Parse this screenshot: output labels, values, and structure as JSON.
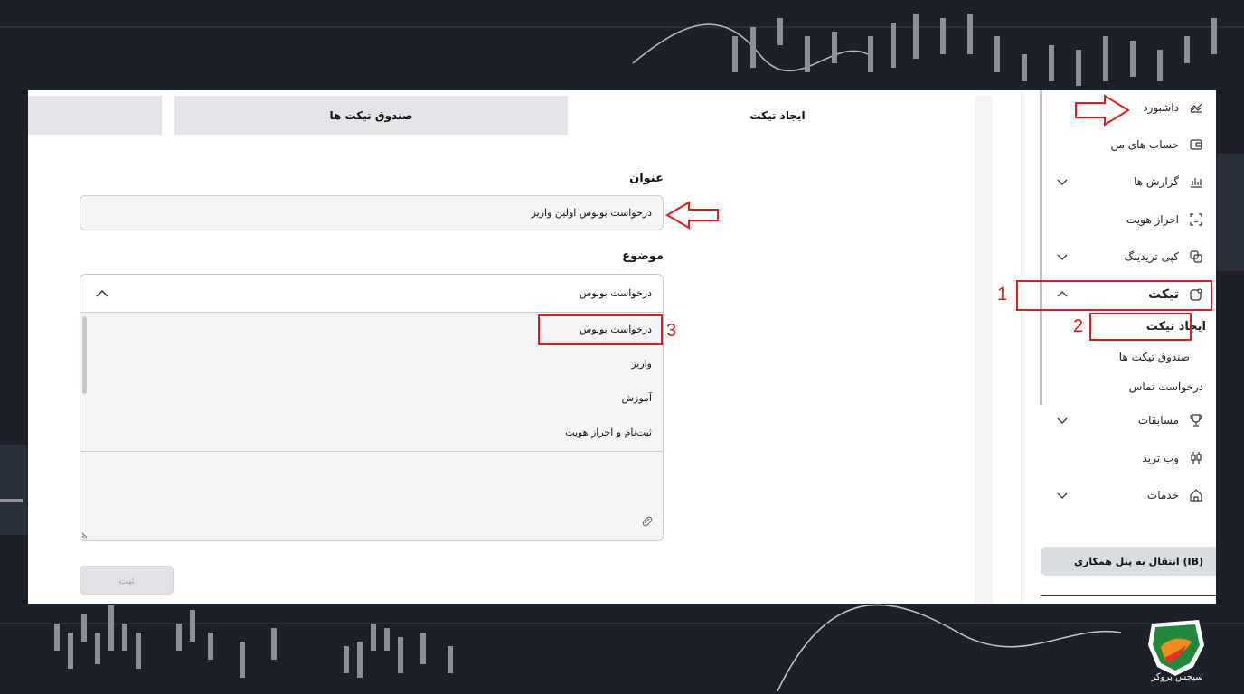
{
  "tabs": {
    "create": "ایجاد تیکت",
    "inbox": "صندوق تیکت ها",
    "blank": ""
  },
  "form": {
    "title_label": "عنوان",
    "title_value": "درخواست بونوس اولین واریز",
    "subject_label": "موضوع",
    "subject_value": "درخواست بونوس",
    "options": [
      "درخواست بونوس",
      "واریز",
      "آموزش",
      "ثبت‌نام و احراز هویت"
    ],
    "submit_label": "ثبت"
  },
  "sidebar": {
    "items": [
      {
        "label": "داشبورد",
        "icon": "chart-icon"
      },
      {
        "label": "حساب های من",
        "icon": "wallet-icon"
      },
      {
        "label": "گزارش ها",
        "icon": "bar-chart-icon"
      },
      {
        "label": "احراز هویت",
        "icon": "face-scan-icon"
      },
      {
        "label": "کپی تریدینگ",
        "icon": "copy-icon"
      },
      {
        "label": "تیکت",
        "icon": "ticket-icon"
      },
      {
        "label": "مسابقات",
        "icon": "trophy-icon"
      },
      {
        "label": "وب ترید",
        "icon": "candles-icon"
      },
      {
        "label": "خدمات",
        "icon": "home-icon"
      }
    ],
    "ticket_sub": [
      "ایجاد تیکت",
      "صندوق تیکت ها",
      "درخواست تماس"
    ],
    "ib_button": "انتقال به پنل همکاری (IB)"
  },
  "annotations": [
    "1",
    "2",
    "3"
  ],
  "brand": {
    "logo_text": "سیجس بروکر",
    "accent": "#e01b1b"
  }
}
